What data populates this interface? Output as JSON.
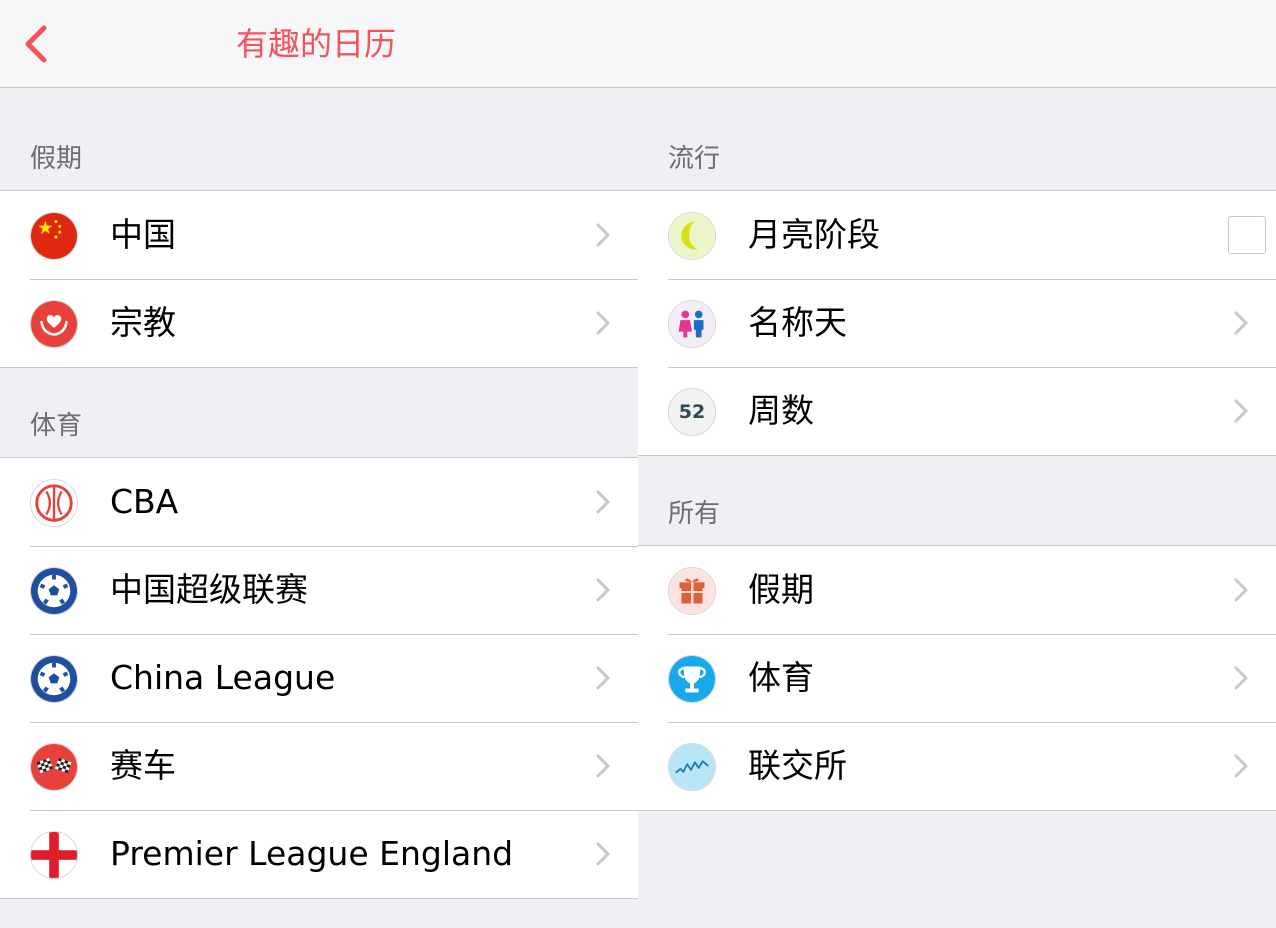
{
  "nav": {
    "title": "有趣的日历",
    "back_icon": "chevron-left-icon"
  },
  "left": {
    "sections": [
      {
        "header": "假期",
        "items": [
          {
            "label": "中国",
            "icon": "china-flag-icon"
          },
          {
            "label": "宗教",
            "icon": "religion-hands-heart-icon"
          }
        ]
      },
      {
        "header": "体育",
        "items": [
          {
            "label": "CBA",
            "icon": "basketball-icon"
          },
          {
            "label": "中国超级联赛",
            "icon": "soccer-ball-icon"
          },
          {
            "label": "China League",
            "icon": "soccer-ball-icon"
          },
          {
            "label": "赛车",
            "icon": "racing-flags-icon"
          },
          {
            "label": "Premier League England",
            "icon": "england-flag-icon"
          }
        ]
      }
    ]
  },
  "right": {
    "sections": [
      {
        "header": "流行",
        "items": [
          {
            "label": "月亮阶段",
            "icon": "moon-icon",
            "accessory": "checkbox",
            "checked": false
          },
          {
            "label": "名称天",
            "icon": "name-day-people-icon"
          },
          {
            "label": "周数",
            "icon": "week-number-icon",
            "badge": "52"
          }
        ]
      },
      {
        "header": "所有",
        "items": [
          {
            "label": "假期",
            "icon": "gift-icon"
          },
          {
            "label": "体育",
            "icon": "trophy-icon"
          },
          {
            "label": "联交所",
            "icon": "stock-chart-icon"
          }
        ]
      }
    ]
  },
  "colors": {
    "accent": "#f5525b",
    "background": "#efeff4",
    "separator": "#c8c7cc"
  }
}
